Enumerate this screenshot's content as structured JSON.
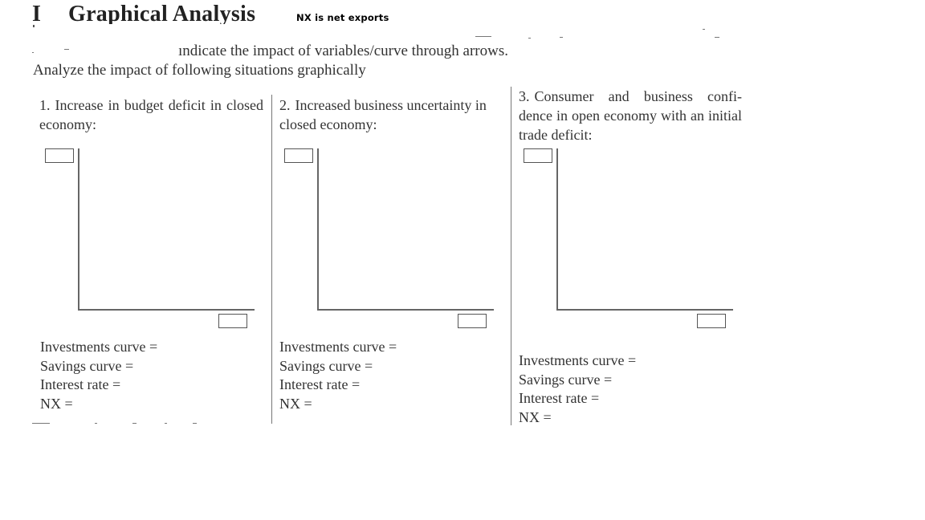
{
  "heading": {
    "section_number": "I",
    "title": "Graphical Analysis",
    "annotation": "NX is net exports"
  },
  "intro": {
    "line1": "ındicate the impact of variables/curve through arrows.",
    "line2": "Analyze the impact of following situations graphically"
  },
  "panels": [
    {
      "number": "1.",
      "prompt": "Increase in budget deficit in closed economy:",
      "y_axis_label_box": "",
      "x_axis_label_box": "",
      "results": [
        {
          "label": "Investments curve =",
          "value": ""
        },
        {
          "label": "Savings curve =",
          "value": ""
        },
        {
          "label": "Interest rate =",
          "value": ""
        },
        {
          "label": "NX =",
          "value": ""
        }
      ]
    },
    {
      "number": "2.",
      "prompt": "Increased business uncertainty in closed economy:",
      "y_axis_label_box": "",
      "x_axis_label_box": "",
      "results": [
        {
          "label": "Investments curve =",
          "value": ""
        },
        {
          "label": "Savings curve =",
          "value": ""
        },
        {
          "label": "Interest rate =",
          "value": ""
        },
        {
          "label": "NX =",
          "value": ""
        }
      ]
    },
    {
      "number": "3.",
      "prompt": "Consumer and business confi- dence in open economy with an initial trade deficit:",
      "y_axis_label_box": "",
      "x_axis_label_box": "",
      "results": [
        {
          "label": "Investments curve =",
          "value": ""
        },
        {
          "label": "Savings curve =",
          "value": ""
        },
        {
          "label": "Interest rate =",
          "value": ""
        },
        {
          "label": "NX =",
          "value": ""
        }
      ]
    }
  ]
}
